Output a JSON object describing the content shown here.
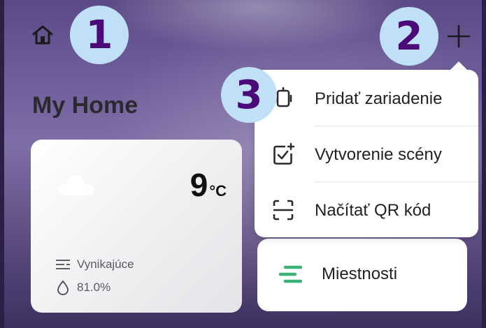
{
  "header": {
    "home_icon": "home-icon",
    "add_icon": "plus-icon"
  },
  "annotations": [
    "1",
    "2",
    "3"
  ],
  "page_title": "My Home",
  "weather": {
    "icon": "cloud-icon",
    "temperature": "9",
    "unit": "°C",
    "air_quality": "Vynikajúce",
    "humidity": "81.0%"
  },
  "rooms": {
    "label": "Miestnosti",
    "icon": "rooms-icon",
    "icon_color": "#3bb27a"
  },
  "add_menu": {
    "items": [
      {
        "label": "Pridať zariadenie",
        "icon": "add-device-icon"
      },
      {
        "label": "Vytvorenie scény",
        "icon": "create-scene-icon"
      },
      {
        "label": "Načítať QR kód",
        "icon": "qr-scan-icon"
      }
    ]
  },
  "colors": {
    "badge_bg": "#bfe0f7",
    "badge_text": "#4b0a78"
  }
}
